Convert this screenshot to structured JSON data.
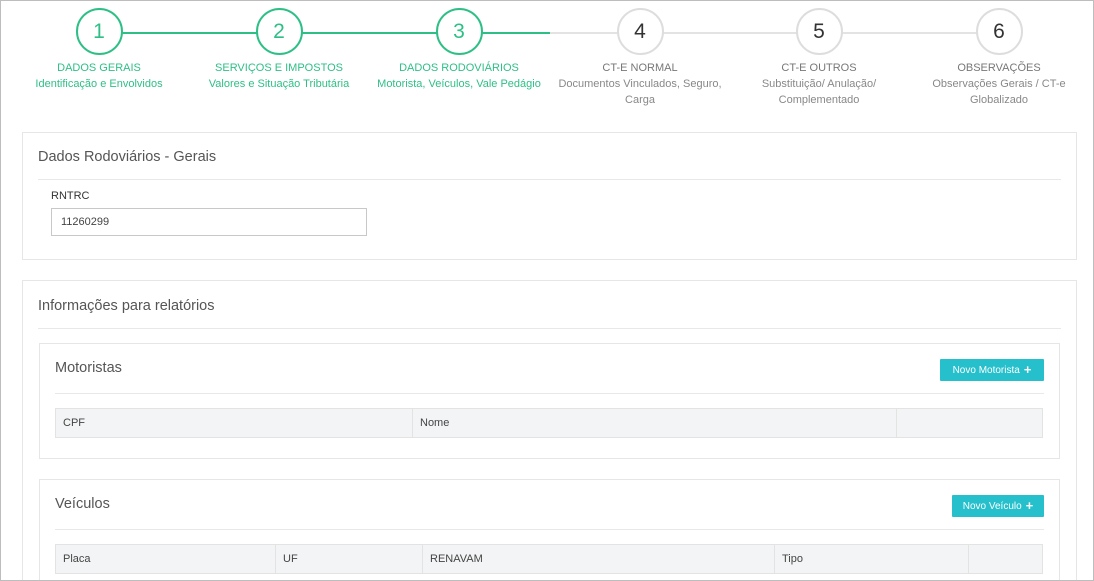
{
  "wizard": {
    "steps": [
      {
        "number": "1",
        "title": "DADOS GERAIS",
        "subtitle": "Identificação e Envolvidos",
        "status": "done"
      },
      {
        "number": "2",
        "title": "SERVIÇOS E IMPOSTOS",
        "subtitle": "Valores e Situação Tributária",
        "status": "done"
      },
      {
        "number": "3",
        "title": "DADOS RODOVIÁRIOS",
        "subtitle": "Motorista, Veículos, Vale Pedágio",
        "status": "done"
      },
      {
        "number": "4",
        "title": "CT-E NORMAL",
        "subtitle": "Documentos Vinculados, Seguro, Carga",
        "status": "todo"
      },
      {
        "number": "5",
        "title": "CT-E OUTROS",
        "subtitle": "Substituição/ Anulação/ Complementado",
        "status": "todo"
      },
      {
        "number": "6",
        "title": "OBSERVAÇÕES",
        "subtitle": "Observações Gerais / CT-e Globalizado",
        "status": "todo"
      }
    ],
    "colors": {
      "done": "#2ebf86",
      "todo": "#e3e3e3"
    }
  },
  "rodoviarios": {
    "title": "Dados Rodoviários - Gerais",
    "rntrc_label": "RNTRC",
    "rntrc_value": "11260299"
  },
  "relatorios": {
    "title": "Informações para relatórios",
    "motoristas": {
      "title": "Motoristas",
      "button_label": "Novo Motorista",
      "columns": [
        "CPF",
        "Nome",
        ""
      ]
    },
    "veiculos": {
      "title": "Veículos",
      "button_label": "Novo Veículo",
      "columns": [
        "Placa",
        "UF",
        "RENAVAM",
        "Tipo",
        ""
      ]
    }
  },
  "accent_color": "#26c0cc"
}
